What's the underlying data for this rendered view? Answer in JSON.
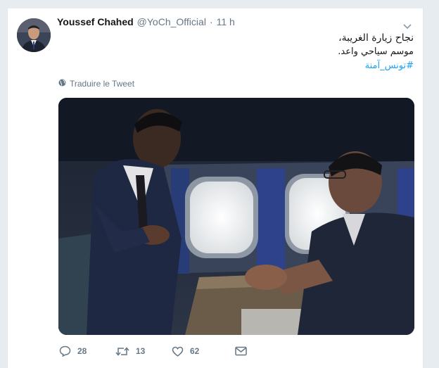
{
  "tweet": {
    "author_name": "Youssef Chahed",
    "handle": "@YoCh_Official",
    "separator": "·",
    "time": "11 h",
    "text_line1": "نجاح زيارة الغريبة،",
    "text_line2": "موسم سياحي واعد.",
    "hashtag": "#تونس_آمنة",
    "translate_label": "Traduire le Tweet",
    "replies": "28",
    "retweets": "13",
    "likes": "62"
  },
  "icons": {
    "caret": "chevron-down-icon",
    "translate": "globe-icon",
    "reply": "reply-icon",
    "retweet": "retweet-icon",
    "like": "heart-icon",
    "message": "envelope-icon"
  },
  "colors": {
    "link": "#1da1f2",
    "secondary_text": "#657786",
    "primary_text": "#14171a",
    "background": "#e6ecf0"
  }
}
